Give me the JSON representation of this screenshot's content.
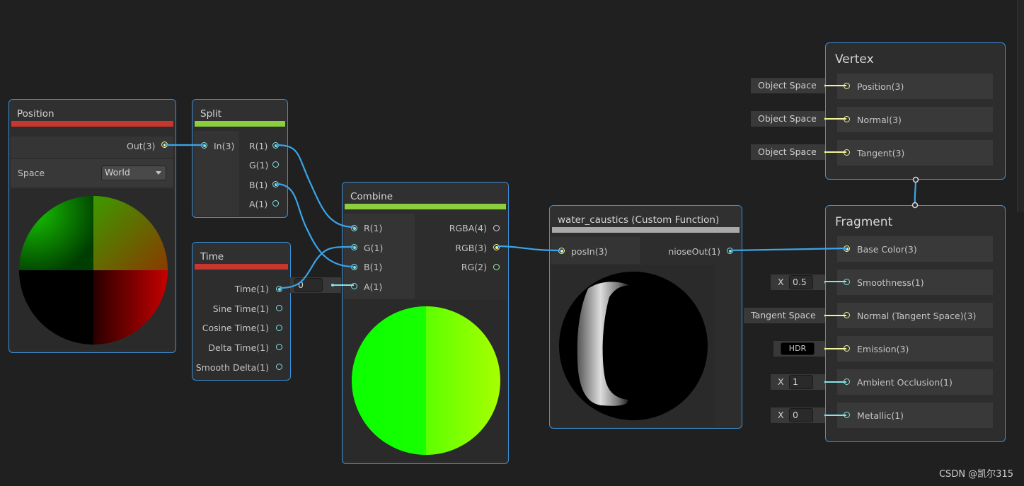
{
  "nodes": {
    "position": {
      "title": "Position",
      "output": "Out(3)",
      "space_label": "Space",
      "space_value": "World"
    },
    "split": {
      "title": "Split",
      "input": "In(3)",
      "outputs": [
        "R(1)",
        "G(1)",
        "B(1)",
        "A(1)"
      ]
    },
    "time": {
      "title": "Time",
      "outputs": [
        "Time(1)",
        "Sine Time(1)",
        "Cosine Time(1)",
        "Delta Time(1)",
        "Smooth Delta(1)"
      ]
    },
    "combine": {
      "title": "Combine",
      "inputs": [
        "R(1)",
        "G(1)",
        "B(1)",
        "A(1)"
      ],
      "outputs": [
        "RGBA(4)",
        "RGB(3)",
        "RG(2)"
      ],
      "a_default": "0"
    },
    "custom": {
      "title": "water_caustics (Custom Function)",
      "input": "posIn(3)",
      "output": "nioseOut(1)"
    },
    "vertex": {
      "title": "Vertex",
      "slots": [
        "Position(3)",
        "Normal(3)",
        "Tangent(3)"
      ],
      "side_values": [
        "Object Space",
        "Object Space",
        "Object Space"
      ]
    },
    "fragment": {
      "title": "Fragment",
      "slots": [
        "Base Color(3)",
        "Smoothness(1)",
        "Normal (Tangent Space)(3)",
        "Emission(3)",
        "Ambient Occlusion(1)",
        "Metallic(1)"
      ],
      "smoothness_x": "X",
      "smoothness_value": "0.5",
      "normal_side": "Tangent Space",
      "emission_badge": "HDR",
      "ao_x": "X",
      "ao_value": "1",
      "metallic_x": "X",
      "metallic_value": "0"
    }
  },
  "colors": {
    "node_border": "#3c8fd6",
    "wire": "#3aa5e8",
    "position_bar": "#c8372d",
    "split_bar": "#8ccf3e",
    "combine_bar": "#8ccf3e",
    "time_bar": "#c8372d",
    "custom_bar": "#a9a9a9"
  },
  "watermark": "CSDN @凯尔315"
}
